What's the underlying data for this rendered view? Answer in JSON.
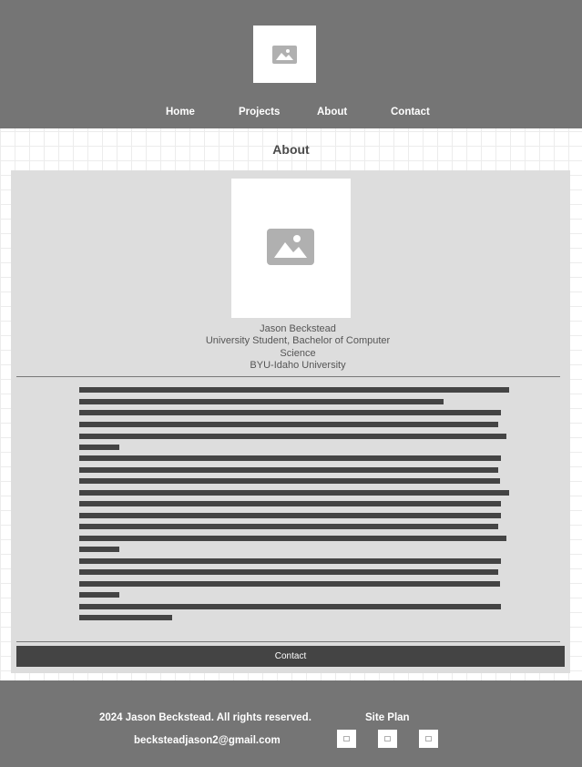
{
  "header": {
    "logo_icon": "image-placeholder-icon",
    "nav": [
      "Home",
      "Projects",
      "About",
      "Contact"
    ]
  },
  "main": {
    "title": "About",
    "profile": {
      "photo_icon": "image-placeholder-icon",
      "name": "Jason Beckstead",
      "role_line1": "University Student, Bachelor of Computer",
      "role_line2": "Science",
      "school": "BYU-Idaho University"
    },
    "bio_placeholder": "redacted text lines",
    "contact_button": "Contact"
  },
  "footer": {
    "copyright": "2024 Jason Beckstead. All rights reserved.",
    "site_plan": "Site Plan",
    "email": "beckstеadjason2@gmail.com",
    "social_icons": [
      "image-placeholder-icon",
      "image-placeholder-icon",
      "image-placeholder-icon"
    ]
  },
  "colors": {
    "header_bg": "#757575",
    "card_bg": "#dddddd",
    "button_bg": "#444444",
    "text_line": "#444444"
  }
}
